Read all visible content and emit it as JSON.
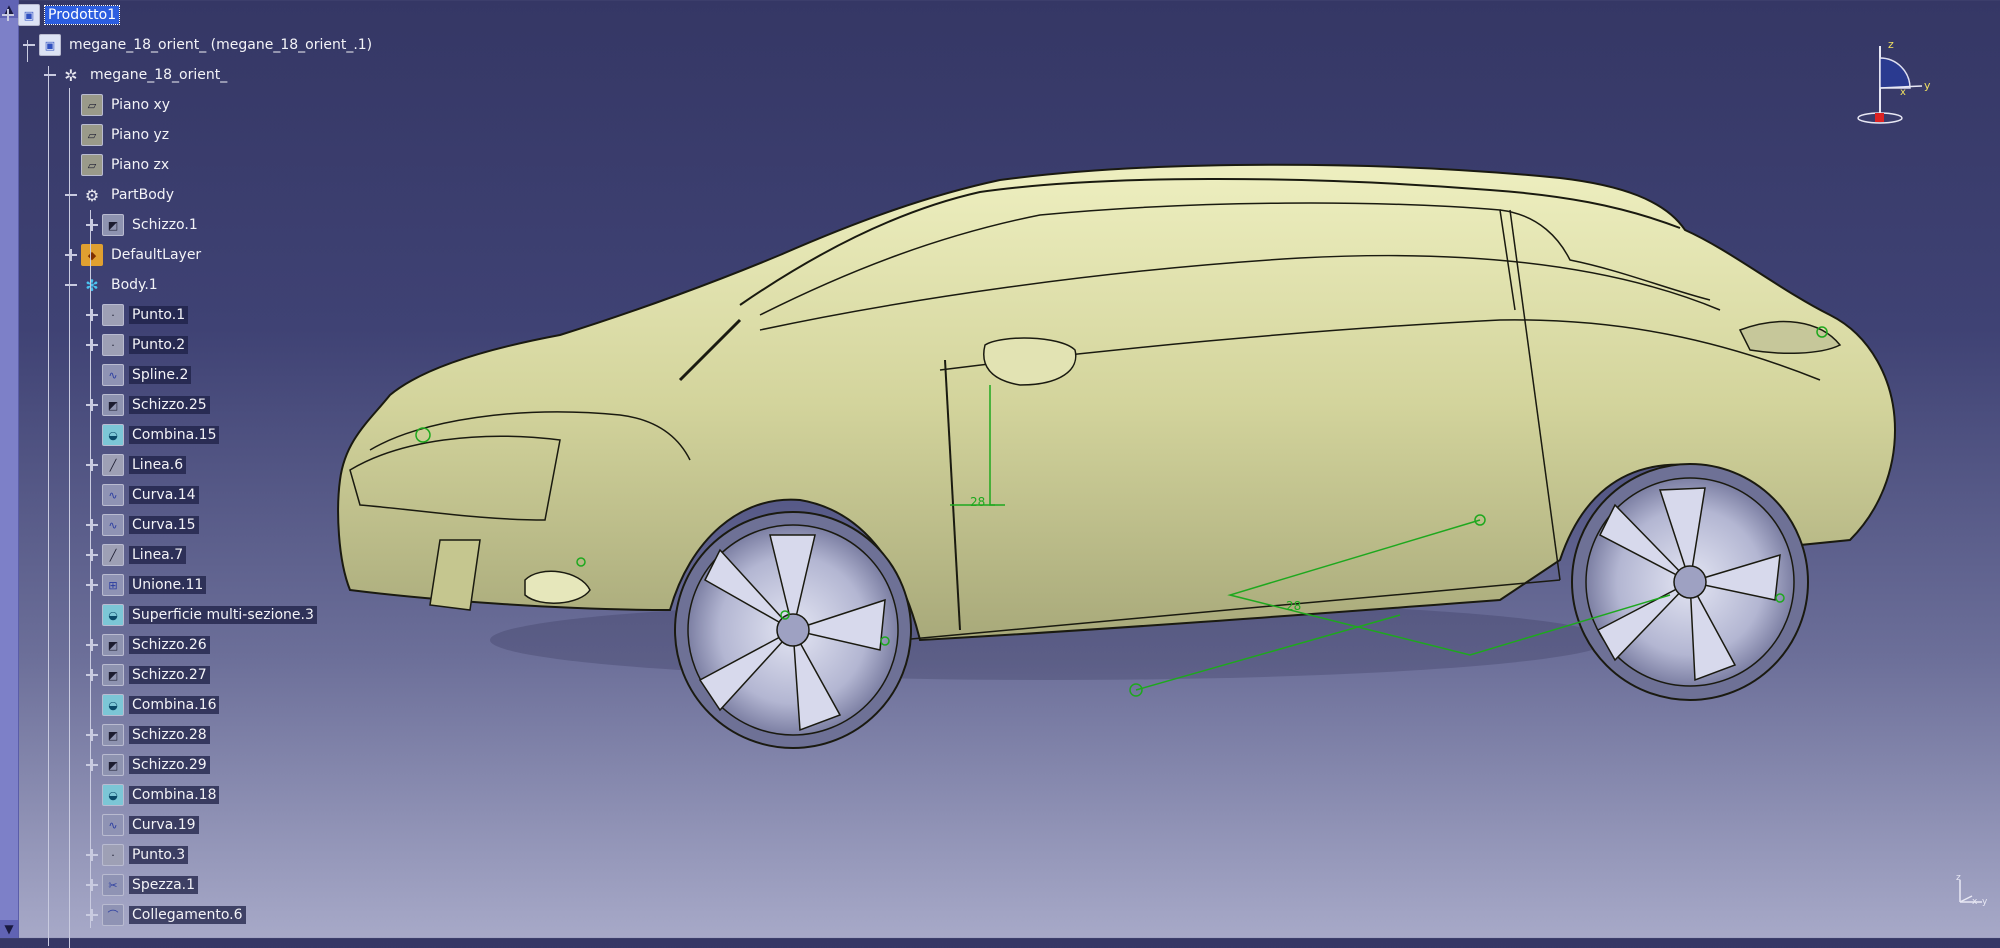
{
  "tree": {
    "items": [
      {
        "label": "Prodotto1",
        "icon": "product-icon",
        "state": "selected"
      },
      {
        "label": "megane_18_orient_ (megane_18_orient_.1)",
        "icon": "product-icon",
        "state": "normal"
      },
      {
        "label": "megane_18_orient_",
        "icon": "part-icon",
        "state": "normal"
      },
      {
        "label": "Piano xy",
        "icon": "plane-icon",
        "state": "normal"
      },
      {
        "label": "Piano yz",
        "icon": "plane-icon",
        "state": "normal"
      },
      {
        "label": "Piano zx",
        "icon": "plane-icon",
        "state": "normal"
      },
      {
        "label": "PartBody",
        "icon": "gear-icon",
        "state": "normal"
      },
      {
        "label": "Schizzo.1",
        "icon": "sketch-icon",
        "state": "normal"
      },
      {
        "label": "DefaultLayer",
        "icon": "layer-icon",
        "state": "normal"
      },
      {
        "label": "Body.1",
        "icon": "body-icon",
        "state": "normal"
      },
      {
        "label": "Punto.1",
        "icon": "point-icon",
        "state": "dim"
      },
      {
        "label": "Punto.2",
        "icon": "point-icon",
        "state": "dim"
      },
      {
        "label": "Spline.2",
        "icon": "curve-icon",
        "state": "dim"
      },
      {
        "label": "Schizzo.25",
        "icon": "sketch-icon",
        "state": "dim"
      },
      {
        "label": "Combina.15",
        "icon": "surface-icon",
        "state": "dim"
      },
      {
        "label": "Linea.6",
        "icon": "line-icon",
        "state": "dim"
      },
      {
        "label": "Curva.14",
        "icon": "curve-icon",
        "state": "dim"
      },
      {
        "label": "Curva.15",
        "icon": "curve-icon",
        "state": "dim"
      },
      {
        "label": "Linea.7",
        "icon": "line-icon",
        "state": "dim"
      },
      {
        "label": "Unione.11",
        "icon": "join-icon",
        "state": "dim"
      },
      {
        "label": "Superficie multi-sezione.3",
        "icon": "surface-icon",
        "state": "dim"
      },
      {
        "label": "Schizzo.26",
        "icon": "sketch-icon",
        "state": "dim"
      },
      {
        "label": "Schizzo.27",
        "icon": "sketch-icon",
        "state": "dim"
      },
      {
        "label": "Combina.16",
        "icon": "surface-icon",
        "state": "dim"
      },
      {
        "label": "Schizzo.28",
        "icon": "sketch-icon",
        "state": "dim"
      },
      {
        "label": "Schizzo.29",
        "icon": "sketch-icon",
        "state": "dim"
      },
      {
        "label": "Combina.18",
        "icon": "surface-icon",
        "state": "dim"
      },
      {
        "label": "Curva.19",
        "icon": "curve-icon",
        "state": "dim"
      },
      {
        "label": "Punto.3",
        "icon": "point-icon",
        "state": "dim"
      },
      {
        "label": "Spezza.1",
        "icon": "split-icon",
        "state": "dim"
      },
      {
        "label": "Collegamento.6",
        "icon": "connect-icon",
        "state": "dim"
      }
    ]
  },
  "compass": {
    "z_label": "z",
    "y_label": "y",
    "x_label": "x"
  },
  "mini_axis": {
    "z_label": "z",
    "x_label": "x",
    "y_label": "y"
  },
  "sketch_dim_labels": [
    "28",
    "28"
  ],
  "colors": {
    "car_body": "#dadca0",
    "car_edge": "#1a1a10",
    "wheel": "#b9bcd6",
    "construction": "#1ea81e",
    "selection": "#2c5de0"
  }
}
